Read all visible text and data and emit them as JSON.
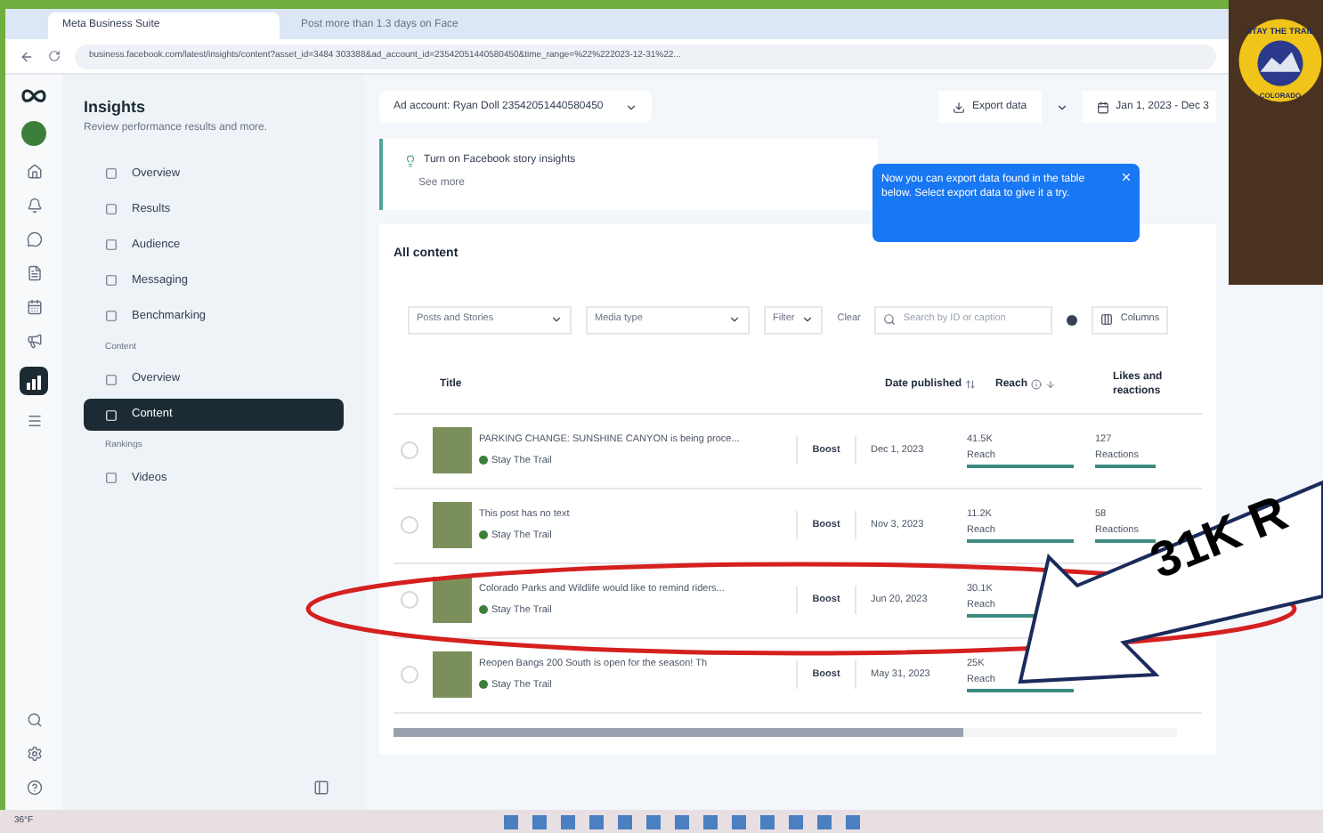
{
  "browser": {
    "tabs": [
      {
        "title": "Meta Business Suite",
        "selected": true
      },
      {
        "title": "Post more than 1.3 days on Face",
        "selected": false
      }
    ],
    "url": "business.facebook.com/latest/insights/content?asset_id=3484 303388&ad_account_id=23542051440580450&time_range=%22%222023-12-31%22..."
  },
  "header": {
    "title": "Insights",
    "subtitle": "Review performance results and more.",
    "account": "Ad account: Ryan Doll 23542051440580450",
    "export": "Export data",
    "date_range": "Jan 1, 2023 - Dec 3"
  },
  "tooltip": {
    "text": "Now you can export data found in the table below. Select export data to give it a try."
  },
  "banner": {
    "text": "Turn on Facebook story insights",
    "link": "See more"
  },
  "sidebar": {
    "items": [
      {
        "kind": "item",
        "label": "Overview",
        "selected": false
      },
      {
        "kind": "item",
        "label": "Results",
        "selected": false
      },
      {
        "kind": "item",
        "label": "Audience",
        "selected": false
      },
      {
        "kind": "item",
        "label": "Messaging",
        "selected": false
      },
      {
        "kind": "item",
        "label": "Benchmarking",
        "selected": false
      },
      {
        "kind": "section",
        "label": "Content"
      },
      {
        "kind": "item",
        "label": "Overview",
        "selected": false
      },
      {
        "kind": "item",
        "label": "Content",
        "selected": true
      },
      {
        "kind": "section",
        "label": "Rankings"
      },
      {
        "kind": "item",
        "label": "Videos",
        "selected": false
      }
    ]
  },
  "content": {
    "title": "All content",
    "filters": [
      "Posts and Stories",
      "Media type"
    ],
    "filter": "Filter",
    "clear": "Clear",
    "search_placeholder": "Search by ID or caption",
    "columns_button": "Columns",
    "columns": [
      "Title",
      "Date published",
      "Reach",
      "Likes and reactions"
    ],
    "rows": [
      {
        "title": "PARKING CHANGE: SUNSHINE CANYON is being proce...",
        "author": "Stay The Trail",
        "boost": "Boost",
        "date": "Dec 1, 2023",
        "reach": "41.5K",
        "reach_label": "Reach",
        "likes": "127",
        "likes_label": "Reactions",
        "selected": false
      },
      {
        "title": "This post has no text",
        "author": "Stay The Trail",
        "boost": "Boost",
        "date": "Nov 3, 2023",
        "reach": "11.2K",
        "reach_label": "Reach",
        "likes": "58",
        "likes_label": "Reactions",
        "selected": false
      },
      {
        "title": "Colorado Parks and Wildlife would like to remind riders...",
        "author": "Stay The Trail",
        "boost": "Boost",
        "date": "Jun 20, 2023",
        "reach": "30.1K",
        "reach_label": "Reach",
        "selected": false
      },
      {
        "title": "Reopen Bangs 200 South is open for the season! Th",
        "author": "Stay The Trail",
        "boost": "Boost",
        "date": "May 31, 2023",
        "reach": "25K",
        "reach_label": "Reach",
        "selected": false
      }
    ]
  },
  "annotation": {
    "text": "31K R"
  },
  "sticker": {
    "top": "STAY THE TRAIL",
    "bottom": "COLORADO"
  },
  "taskbar": {
    "weather": "36°F"
  }
}
